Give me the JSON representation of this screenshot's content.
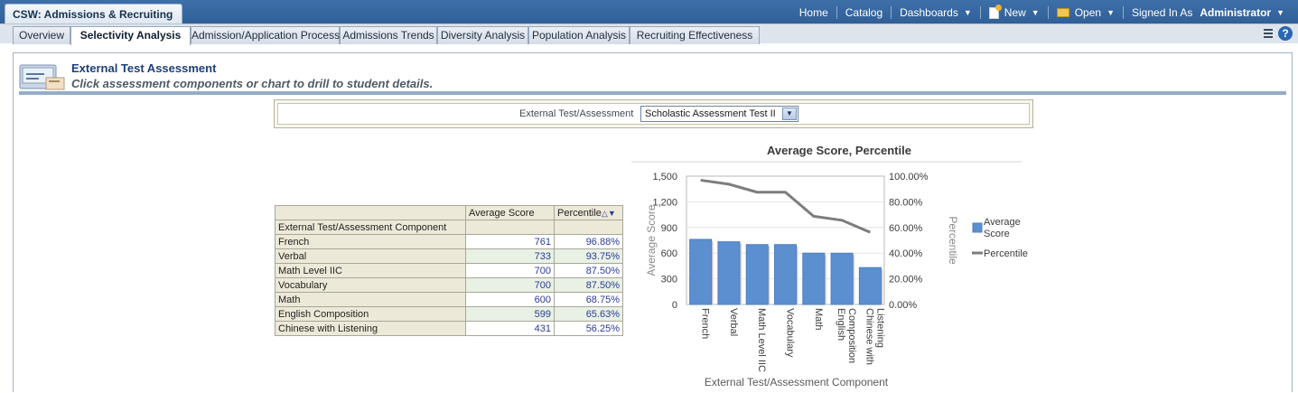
{
  "app_title": "CSW: Admissions & Recruiting",
  "global_nav": {
    "home": "Home",
    "catalog": "Catalog",
    "dashboards": "Dashboards",
    "new": "New",
    "open": "Open",
    "signed_in_as": "Signed In As",
    "user": "Administrator"
  },
  "tabs": [
    {
      "label": "Overview"
    },
    {
      "label": "Selectivity Analysis",
      "active": true
    },
    {
      "label": "Admission/Application Process"
    },
    {
      "label": "Admissions Trends"
    },
    {
      "label": "Diversity Analysis"
    },
    {
      "label": "Population Analysis"
    },
    {
      "label": "Recruiting Effectiveness"
    }
  ],
  "section": {
    "title": "External Test Assessment",
    "subtitle": "Click assessment components or chart to drill to student details."
  },
  "prompt": {
    "label": "External Test/Assessment",
    "value": "Scholastic Assessment Test II"
  },
  "table": {
    "headers": [
      "Average Score",
      "Percentile"
    ],
    "row_header": "External Test/Assessment Component",
    "rows": [
      {
        "component": "French",
        "avg": "761",
        "pct": "96.88%"
      },
      {
        "component": "Verbal",
        "avg": "733",
        "pct": "93.75%"
      },
      {
        "component": "Math Level IIC",
        "avg": "700",
        "pct": "87.50%"
      },
      {
        "component": "Vocabulary",
        "avg": "700",
        "pct": "87.50%"
      },
      {
        "component": "Math",
        "avg": "600",
        "pct": "68.75%"
      },
      {
        "component": "English Composition",
        "avg": "599",
        "pct": "65.63%"
      },
      {
        "component": "Chinese with Listening",
        "avg": "431",
        "pct": "56.25%"
      }
    ]
  },
  "chart_data": {
    "type": "bar",
    "title": "Average Score, Percentile",
    "xlabel": "External Test/Assessment Component",
    "ylabel": "Average Score",
    "y2label": "Percentile",
    "categories": [
      "French",
      "Verbal",
      "Math Level IIC",
      "Vocabulary",
      "Math",
      "English Composition",
      "Chinese with Listening"
    ],
    "category_labels": [
      [
        "French"
      ],
      [
        "Verbal"
      ],
      [
        "Math Level IIC"
      ],
      [
        "Vocabulary"
      ],
      [
        "Math"
      ],
      [
        "English",
        "Composition"
      ],
      [
        "Chinese with",
        "Listening"
      ]
    ],
    "series": [
      {
        "name": "Average Score",
        "type": "bar",
        "axis": "left",
        "values": [
          761,
          733,
          700,
          700,
          600,
          599,
          431
        ],
        "color": "#5b8fd0"
      },
      {
        "name": "Percentile",
        "type": "line",
        "axis": "right",
        "values": [
          96.88,
          93.75,
          87.5,
          87.5,
          68.75,
          65.63,
          56.25
        ],
        "color": "#7d7d7d"
      }
    ],
    "ylim": [
      0,
      1500
    ],
    "y_ticks": [
      "0",
      "300",
      "600",
      "900",
      "1,200",
      "1,500"
    ],
    "y2lim": [
      0,
      100
    ],
    "y2_ticks": [
      "0.00%",
      "20.00%",
      "40.00%",
      "60.00%",
      "80.00%",
      "100.00%"
    ],
    "legend": [
      "Average Score",
      "Percentile"
    ],
    "legend_position": "right",
    "grid": true
  }
}
